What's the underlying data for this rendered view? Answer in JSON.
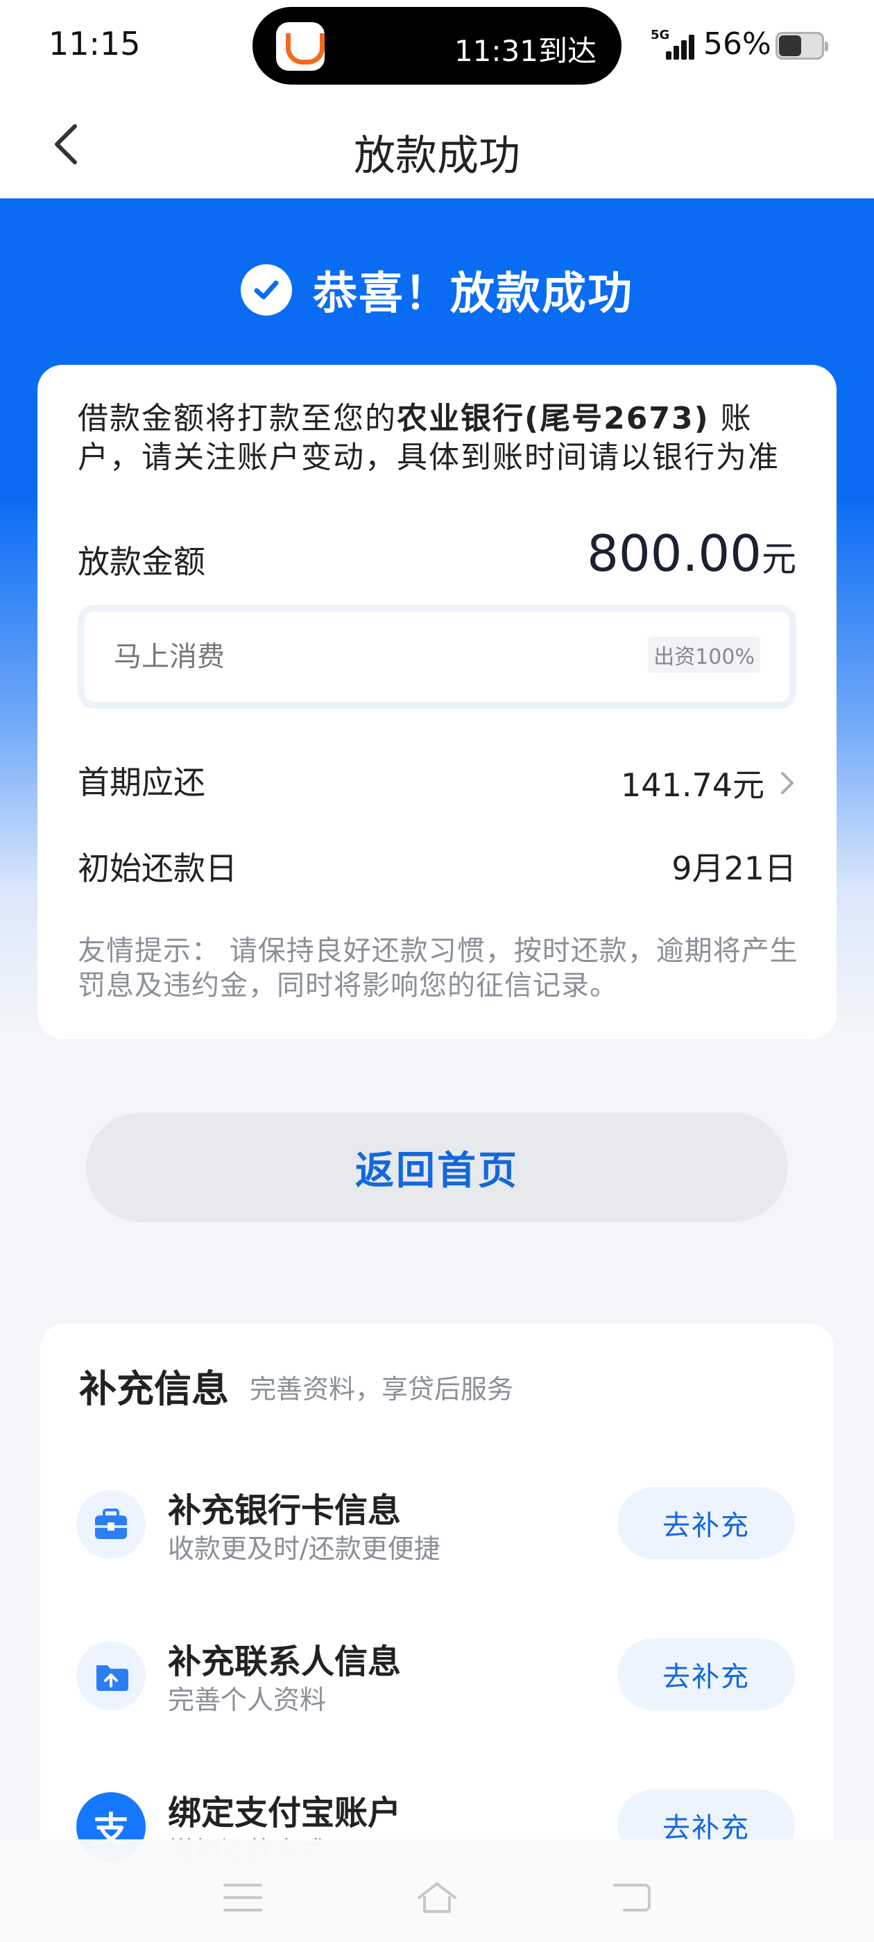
{
  "status_bar": {
    "time": "11:15",
    "island_text": "11:31到达",
    "network": "5G",
    "battery": "56%"
  },
  "nav": {
    "title": "放款成功"
  },
  "hero": {
    "success_text": "恭喜！放款成功"
  },
  "main_card": {
    "notice_prefix": "借款金额将打款至您的",
    "notice_bank": "农业银行(尾号2673)",
    "notice_suffix": " 账户，请关注账户变动，具体到账时间请以银行为准",
    "amount_label": "放款金额",
    "amount_value": "800.00",
    "amount_unit": "元",
    "lender_name": "马上消费",
    "lender_ratio": "出资100%",
    "first_label": "首期应还",
    "first_value": "141.74元",
    "date_label": "初始还款日",
    "date_value": "9月21日",
    "tip": "友情提示： 请保持良好还款习惯，按时还款，逾期将产生罚息及违约金，同时将影响您的征信记录。"
  },
  "home_button": "返回首页",
  "supplement": {
    "title": "补充信息",
    "subtitle": "完善资料，享贷后服务",
    "items": [
      {
        "title": "补充银行卡信息",
        "desc": "收款更及时/还款更便捷",
        "button": "去补充",
        "icon": "bank-card-icon"
      },
      {
        "title": "补充联系人信息",
        "desc": "完善个人资料",
        "button": "去补充",
        "icon": "contact-icon"
      },
      {
        "title": "绑定支付宝账户",
        "desc": "增加还款方式",
        "button": "去补充",
        "icon": "alipay-icon"
      }
    ]
  },
  "colors": {
    "brand_blue": "#0a6cf3",
    "button_text_blue": "#1268dd"
  }
}
